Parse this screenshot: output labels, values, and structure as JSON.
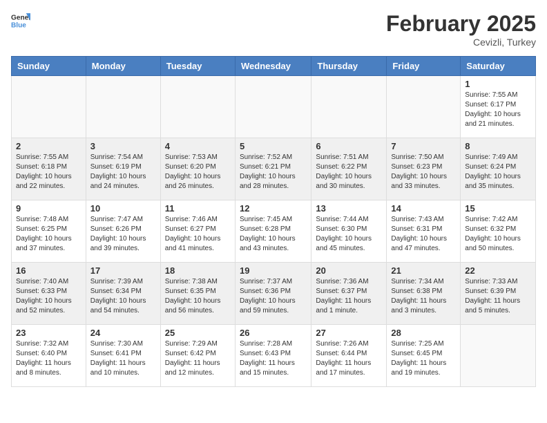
{
  "header": {
    "logo_line1": "General",
    "logo_line2": "Blue",
    "month_year": "February 2025",
    "location": "Cevizli, Turkey"
  },
  "weekdays": [
    "Sunday",
    "Monday",
    "Tuesday",
    "Wednesday",
    "Thursday",
    "Friday",
    "Saturday"
  ],
  "weeks": [
    [
      {
        "day": "",
        "info": ""
      },
      {
        "day": "",
        "info": ""
      },
      {
        "day": "",
        "info": ""
      },
      {
        "day": "",
        "info": ""
      },
      {
        "day": "",
        "info": ""
      },
      {
        "day": "",
        "info": ""
      },
      {
        "day": "1",
        "info": "Sunrise: 7:55 AM\nSunset: 6:17 PM\nDaylight: 10 hours\nand 21 minutes."
      }
    ],
    [
      {
        "day": "2",
        "info": "Sunrise: 7:55 AM\nSunset: 6:18 PM\nDaylight: 10 hours\nand 22 minutes."
      },
      {
        "day": "3",
        "info": "Sunrise: 7:54 AM\nSunset: 6:19 PM\nDaylight: 10 hours\nand 24 minutes."
      },
      {
        "day": "4",
        "info": "Sunrise: 7:53 AM\nSunset: 6:20 PM\nDaylight: 10 hours\nand 26 minutes."
      },
      {
        "day": "5",
        "info": "Sunrise: 7:52 AM\nSunset: 6:21 PM\nDaylight: 10 hours\nand 28 minutes."
      },
      {
        "day": "6",
        "info": "Sunrise: 7:51 AM\nSunset: 6:22 PM\nDaylight: 10 hours\nand 30 minutes."
      },
      {
        "day": "7",
        "info": "Sunrise: 7:50 AM\nSunset: 6:23 PM\nDaylight: 10 hours\nand 33 minutes."
      },
      {
        "day": "8",
        "info": "Sunrise: 7:49 AM\nSunset: 6:24 PM\nDaylight: 10 hours\nand 35 minutes."
      }
    ],
    [
      {
        "day": "9",
        "info": "Sunrise: 7:48 AM\nSunset: 6:25 PM\nDaylight: 10 hours\nand 37 minutes."
      },
      {
        "day": "10",
        "info": "Sunrise: 7:47 AM\nSunset: 6:26 PM\nDaylight: 10 hours\nand 39 minutes."
      },
      {
        "day": "11",
        "info": "Sunrise: 7:46 AM\nSunset: 6:27 PM\nDaylight: 10 hours\nand 41 minutes."
      },
      {
        "day": "12",
        "info": "Sunrise: 7:45 AM\nSunset: 6:28 PM\nDaylight: 10 hours\nand 43 minutes."
      },
      {
        "day": "13",
        "info": "Sunrise: 7:44 AM\nSunset: 6:30 PM\nDaylight: 10 hours\nand 45 minutes."
      },
      {
        "day": "14",
        "info": "Sunrise: 7:43 AM\nSunset: 6:31 PM\nDaylight: 10 hours\nand 47 minutes."
      },
      {
        "day": "15",
        "info": "Sunrise: 7:42 AM\nSunset: 6:32 PM\nDaylight: 10 hours\nand 50 minutes."
      }
    ],
    [
      {
        "day": "16",
        "info": "Sunrise: 7:40 AM\nSunset: 6:33 PM\nDaylight: 10 hours\nand 52 minutes."
      },
      {
        "day": "17",
        "info": "Sunrise: 7:39 AM\nSunset: 6:34 PM\nDaylight: 10 hours\nand 54 minutes."
      },
      {
        "day": "18",
        "info": "Sunrise: 7:38 AM\nSunset: 6:35 PM\nDaylight: 10 hours\nand 56 minutes."
      },
      {
        "day": "19",
        "info": "Sunrise: 7:37 AM\nSunset: 6:36 PM\nDaylight: 10 hours\nand 59 minutes."
      },
      {
        "day": "20",
        "info": "Sunrise: 7:36 AM\nSunset: 6:37 PM\nDaylight: 11 hours\nand 1 minute."
      },
      {
        "day": "21",
        "info": "Sunrise: 7:34 AM\nSunset: 6:38 PM\nDaylight: 11 hours\nand 3 minutes."
      },
      {
        "day": "22",
        "info": "Sunrise: 7:33 AM\nSunset: 6:39 PM\nDaylight: 11 hours\nand 5 minutes."
      }
    ],
    [
      {
        "day": "23",
        "info": "Sunrise: 7:32 AM\nSunset: 6:40 PM\nDaylight: 11 hours\nand 8 minutes."
      },
      {
        "day": "24",
        "info": "Sunrise: 7:30 AM\nSunset: 6:41 PM\nDaylight: 11 hours\nand 10 minutes."
      },
      {
        "day": "25",
        "info": "Sunrise: 7:29 AM\nSunset: 6:42 PM\nDaylight: 11 hours\nand 12 minutes."
      },
      {
        "day": "26",
        "info": "Sunrise: 7:28 AM\nSunset: 6:43 PM\nDaylight: 11 hours\nand 15 minutes."
      },
      {
        "day": "27",
        "info": "Sunrise: 7:26 AM\nSunset: 6:44 PM\nDaylight: 11 hours\nand 17 minutes."
      },
      {
        "day": "28",
        "info": "Sunrise: 7:25 AM\nSunset: 6:45 PM\nDaylight: 11 hours\nand 19 minutes."
      },
      {
        "day": "",
        "info": ""
      }
    ]
  ]
}
